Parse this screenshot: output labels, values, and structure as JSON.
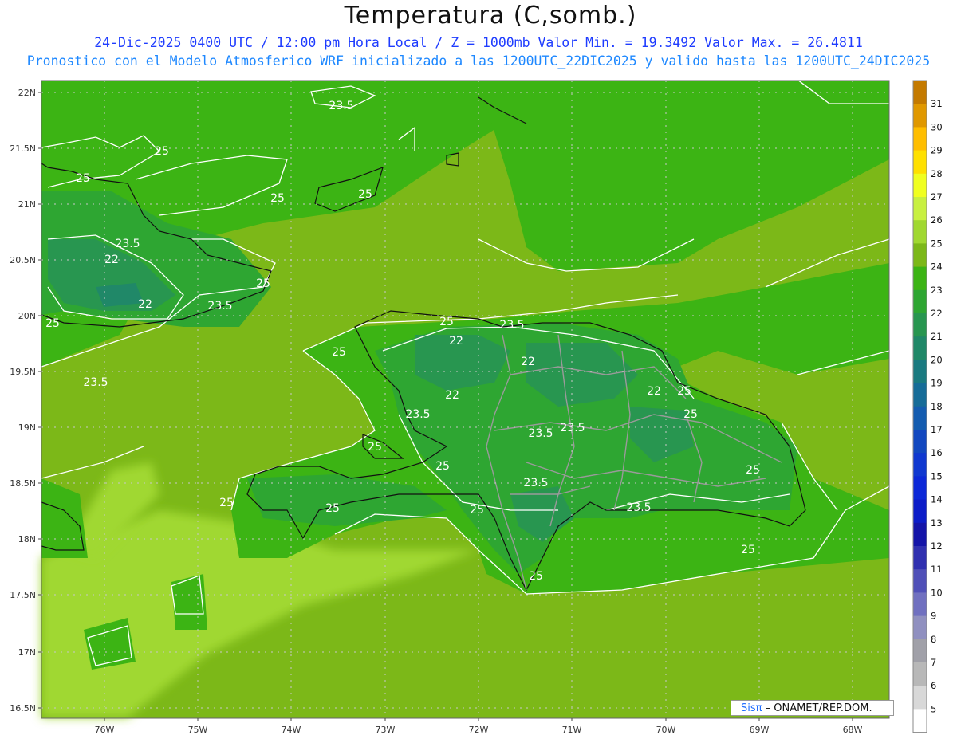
{
  "header": {
    "title": "Temperatura (C,somb.)",
    "subtitle_1": "24-Dic-2025 0400 UTC / 12:00 pm Hora Local / Z = 1000mb  Valor Min. = 19.3492  Valor Max. = 26.4811",
    "subtitle_2": "Pronostico con el Modelo Atmosferico WRF inicializado a las 1200UTC_22DIC2025 y valido hasta las  1200UTC_24DIC2025"
  },
  "map": {
    "lat_labels": [
      "22N",
      "21.5N",
      "21N",
      "20.5N",
      "20N",
      "19.5N",
      "19N",
      "18.5N",
      "18N",
      "17.5N",
      "17N",
      "16.5N"
    ],
    "lon_labels": [
      "76W",
      "75W",
      "74W",
      "73W",
      "72W",
      "71W",
      "70W",
      "69W",
      "68W"
    ],
    "contour_labels": [
      "23.5",
      "25",
      "25",
      "25",
      "25",
      "23.5",
      "22",
      "22",
      "23.5",
      "25",
      "23.5",
      "25",
      "25",
      "25",
      "23.5",
      "22",
      "22",
      "22",
      "23.5",
      "25",
      "23.5",
      "23.5",
      "22",
      "25",
      "25",
      "25",
      "23.5",
      "25",
      "23.5",
      "25",
      "25",
      "25",
      "25",
      "25"
    ]
  },
  "colorbar": {
    "levels": [
      "31",
      "30",
      "29",
      "28",
      "27",
      "26",
      "25",
      "24",
      "23",
      "22",
      "21",
      "20",
      "19",
      "18",
      "17",
      "16",
      "15",
      "14",
      "13",
      "12",
      "11",
      "10",
      "9",
      "8",
      "7",
      "6",
      "5"
    ],
    "colors": [
      "#c47a00",
      "#e09800",
      "#ffbe00",
      "#ffe000",
      "#f0ff20",
      "#c8f040",
      "#a0d830",
      "#7cb818",
      "#3cb414",
      "#2ea632",
      "#289650",
      "#208868",
      "#1a7a80",
      "#166c98",
      "#145cb0",
      "#1248c0",
      "#1038d0",
      "#0c28d8",
      "#0c1cc8",
      "#1414a8",
      "#3030b0",
      "#5050b8",
      "#7070c0",
      "#9090c0",
      "#a0a0a8",
      "#b8b8b8",
      "#d8d8d8",
      "#ffffff"
    ]
  },
  "credit": {
    "brand": "Sisπ",
    "text": " – ONAMET/REP.DOM."
  }
}
